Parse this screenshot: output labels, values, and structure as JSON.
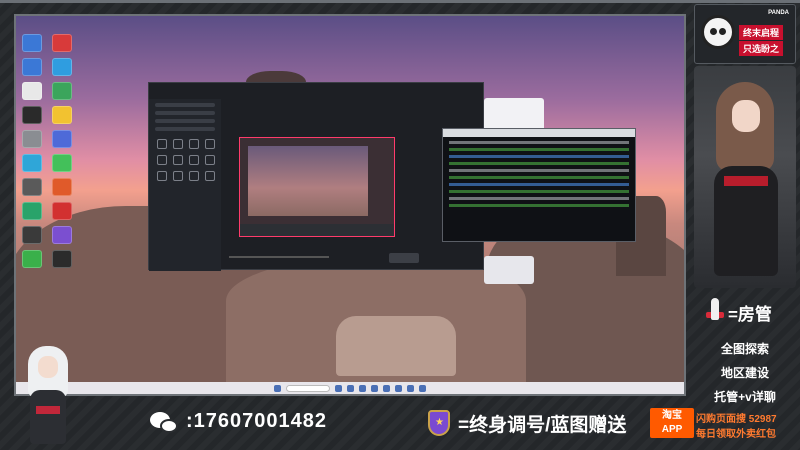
{
  "banner": {
    "brand": "PANDA",
    "line1": "终末启程",
    "line2": "只选盼之"
  },
  "right_panel": {
    "title": "=房管",
    "items": [
      "全图探索",
      "地区建设",
      "托管+v详聊"
    ]
  },
  "contact": {
    "phone": ":17607001482"
  },
  "slogan": "=终身调号/蓝图赠送",
  "taobao": {
    "line1": "淘宝",
    "line2": "APP"
  },
  "promo": {
    "line1": "闪购页面搜 52987",
    "line2": "每日领取外卖红包"
  },
  "colors": {
    "accent_red": "#c8102e",
    "taobao_orange": "#ff5a00",
    "promo_orange": "#ff7a2f"
  },
  "icons": [
    "panda-icon",
    "rocket-icon",
    "wechat-icon",
    "badge-icon"
  ]
}
